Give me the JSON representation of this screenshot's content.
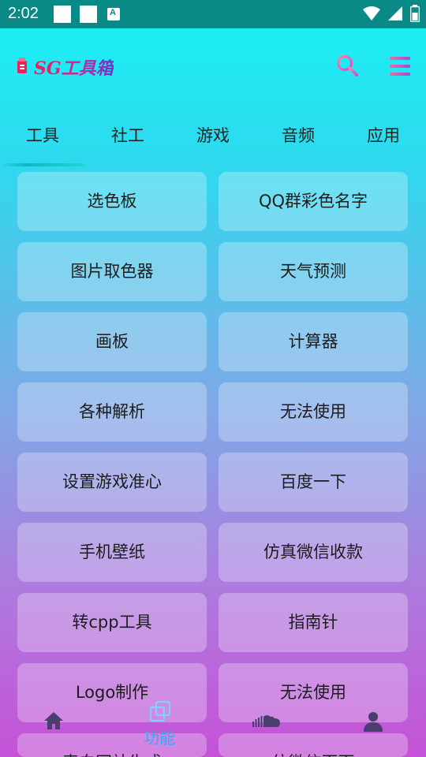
{
  "status_bar": {
    "time": "2:02",
    "notification_icon": "A"
  },
  "header": {
    "title": "SG工具箱",
    "search_icon": "search-icon",
    "menu_icon": "menu-icon"
  },
  "tabs": [
    {
      "label": "工具",
      "active": true
    },
    {
      "label": "社工",
      "active": false
    },
    {
      "label": "游戏",
      "active": false
    },
    {
      "label": "音频",
      "active": false
    },
    {
      "label": "应用",
      "active": false
    }
  ],
  "tools": [
    "选色板",
    "QQ群彩色名字",
    "图片取色器",
    "天气预测",
    "画板",
    "计算器",
    "各种解析",
    "无法使用",
    "设置游戏准心",
    "百度一下",
    "手机壁纸",
    "仿真微信收款",
    "转cpp工具",
    "指南针",
    "Logo制作",
    "无法使用",
    "表白网站生成",
    "仿微信页面"
  ],
  "bottom_nav": {
    "active_label": "功能",
    "items": [
      "home-icon",
      "function-icon",
      "music-icon",
      "user-icon"
    ]
  },
  "colors": {
    "accent": "#3aa7f5",
    "status_bar": "#0a8a86",
    "gradient_top": "#19f3f6",
    "gradient_bottom": "#c552d6"
  }
}
